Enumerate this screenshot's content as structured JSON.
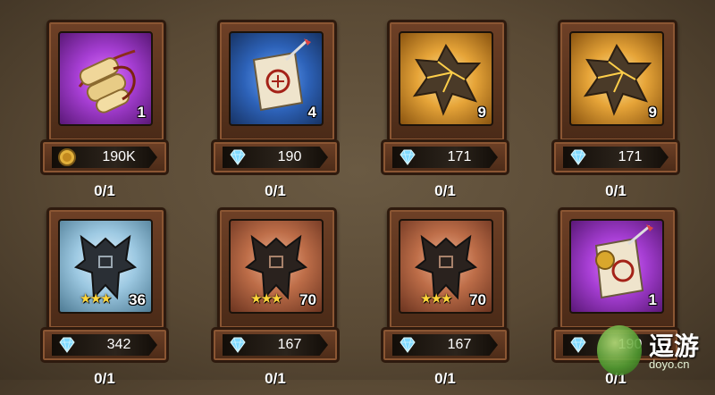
{
  "items": [
    {
      "name": "scroll-bundle",
      "rarity": "purple",
      "count": "1",
      "price": "190K",
      "currency": "gold-coin-icon",
      "limit": "0/1",
      "stars": ""
    },
    {
      "name": "map-scroll",
      "rarity": "blue",
      "count": "4",
      "price": "190",
      "currency": "diamond-icon",
      "limit": "0/1",
      "stars": ""
    },
    {
      "name": "gold-crystal",
      "rarity": "gold",
      "count": "9",
      "price": "171",
      "currency": "diamond-icon",
      "limit": "0/1",
      "stars": ""
    },
    {
      "name": "gold-crystal",
      "rarity": "gold",
      "count": "9",
      "price": "171",
      "currency": "diamond-icon",
      "limit": "0/1",
      "stars": ""
    },
    {
      "name": "ice-emblem",
      "rarity": "ice",
      "count": "36",
      "price": "342",
      "currency": "diamond-icon",
      "limit": "0/1",
      "stars": "★★★"
    },
    {
      "name": "copper-emblem",
      "rarity": "copper",
      "count": "70",
      "price": "167",
      "currency": "diamond-icon",
      "limit": "0/1",
      "stars": "★★★"
    },
    {
      "name": "copper-emblem",
      "rarity": "copper",
      "count": "70",
      "price": "167",
      "currency": "diamond-icon",
      "limit": "0/1",
      "stars": "★★★"
    },
    {
      "name": "sealed-map-scroll",
      "rarity": "purple",
      "count": "1",
      "price": "190",
      "currency": "diamond-icon",
      "limit": "0/1",
      "stars": ""
    }
  ],
  "watermark": {
    "text": "逗游",
    "url": "doyo.cn"
  },
  "colors": {
    "diamond": "#7fd9ff",
    "coin": "#e3b13b",
    "frame": "#6e4026"
  }
}
